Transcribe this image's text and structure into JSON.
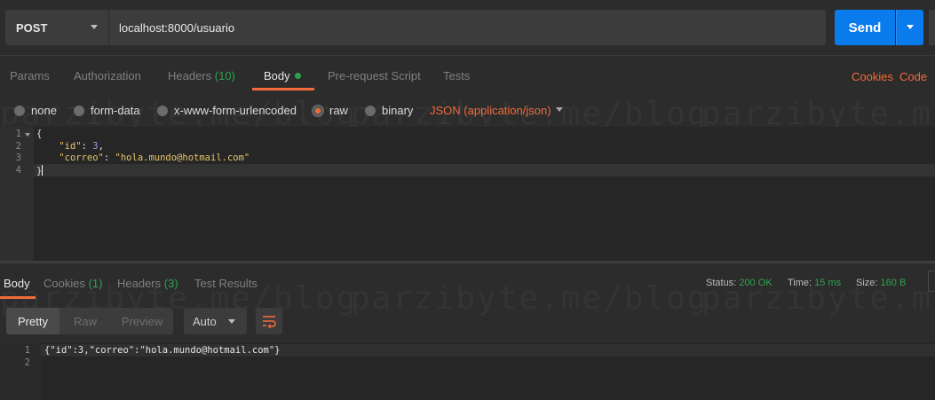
{
  "request": {
    "method": "POST",
    "url": "localhost:8000/usuario",
    "send_label": "Send"
  },
  "request_tabs": [
    {
      "label": "Params",
      "count": ""
    },
    {
      "label": "Authorization",
      "count": ""
    },
    {
      "label": "Headers",
      "count": "(10)"
    },
    {
      "label": "Body",
      "count": ""
    },
    {
      "label": "Pre-request Script",
      "count": ""
    },
    {
      "label": "Tests",
      "count": ""
    }
  ],
  "request_links": {
    "cookies": "Cookies",
    "code": "Code"
  },
  "body_types": {
    "none": "none",
    "form_data": "form-data",
    "urlencoded": "x-www-form-urlencoded",
    "raw": "raw",
    "binary": "binary",
    "selected": "raw",
    "format": "JSON (application/json)"
  },
  "editor": {
    "line_numbers": [
      "1",
      "2",
      "3",
      "4"
    ],
    "lines": {
      "l1": "{",
      "l2_key": "\"id\"",
      "l2_sep": ": ",
      "l2_val": "3",
      "l2_end": ",",
      "l3_key": "\"correo\"",
      "l3_sep": ": ",
      "l3_val": "\"hola.mundo@hotmail.com\"",
      "l4": "}"
    }
  },
  "response_tabs": [
    {
      "label": "Body",
      "count": ""
    },
    {
      "label": "Cookies",
      "count": "(1)"
    },
    {
      "label": "Headers",
      "count": "(3)"
    },
    {
      "label": "Test Results",
      "count": ""
    }
  ],
  "response_status": {
    "status_label": "Status:",
    "status_value": "200 OK",
    "time_label": "Time:",
    "time_value": "15 ms",
    "size_label": "Size:",
    "size_value": "160 B"
  },
  "response_view": {
    "pretty": "Pretty",
    "raw": "Raw",
    "preview": "Preview",
    "format": "Auto"
  },
  "response_body": {
    "line_numbers": [
      "1",
      "2"
    ],
    "line1": "{\"id\":3,\"correo\":\"hola.mundo@hotmail.com\"}"
  },
  "watermark": "parzibyte.me/blog",
  "colors": {
    "accent": "#f26b3a",
    "send": "#097bed",
    "success": "#2ea34f",
    "background": "#2c2c2c"
  }
}
